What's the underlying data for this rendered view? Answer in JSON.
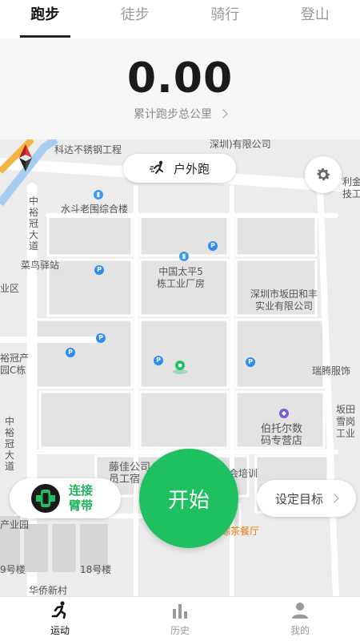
{
  "tabs": [
    {
      "label": "跑步",
      "active": true
    },
    {
      "label": "徒步",
      "active": false
    },
    {
      "label": "骑行",
      "active": false
    },
    {
      "label": "登山",
      "active": false
    }
  ],
  "stats": {
    "distance": "0.00",
    "total_label": "累计跑步总公里"
  },
  "map": {
    "labels": {
      "kedabuxiu": "科达不锈钢工程",
      "youxian": "深圳)有限公司",
      "shuidou": "水斗老围综合楼",
      "zhongyaguan": "中\n裕\n冠\n大\n道",
      "zhongyaguan2": "中\n裕\n冠\n大\n道",
      "cainiao": "菜鸟驿站",
      "taiping": "中国太平5\n栋工业厂房",
      "pingshan": "深圳市坂田和丰\n实业有限公司",
      "ruiteng": "瑞腾服饰",
      "botuoer": "伯托尔数\n码专营店",
      "banjia": "坂田\n雪岗\n工业",
      "lijin": "利金\n技工",
      "quyu": "业区",
      "guanchan": "裕冠产\n园C栋",
      "tengjia": "藤佳公司\n员工宿",
      "peixun": "会培训",
      "chanyeyuan": "产业园",
      "cha": "综茶餐厅",
      "hao18": "18号楼",
      "hao9": "9号楼",
      "huaqiao": "华侨新村"
    }
  },
  "controls": {
    "outdoor_run": "户外跑",
    "band_label": "连接\n臂带",
    "start": "开始",
    "set_goal": "设定目标"
  },
  "nav": [
    {
      "label": "运动",
      "icon": "runner-icon",
      "active": true
    },
    {
      "label": "历史",
      "icon": "bar-chart-icon",
      "active": false
    },
    {
      "label": "我的",
      "icon": "person-icon",
      "active": false
    }
  ],
  "colors": {
    "accent": "#1ec060",
    "poi": "#2d8cf0"
  }
}
